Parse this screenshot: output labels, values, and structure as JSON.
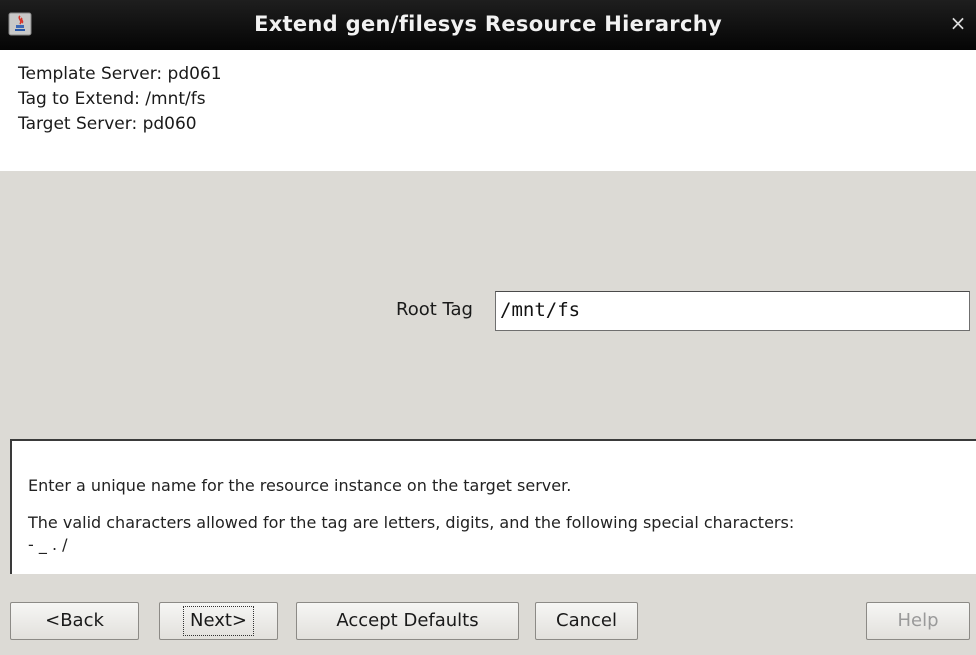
{
  "window": {
    "title": "Extend gen/filesys Resource Hierarchy",
    "close_glyph": "×"
  },
  "info": {
    "template_server": "Template Server: pd061",
    "tag_to_extend": "Tag to Extend: /mnt/fs",
    "target_server": "Target Server: pd060"
  },
  "form": {
    "root_tag_label": "Root Tag",
    "root_tag_value": "/mnt/fs"
  },
  "description": {
    "line1": "Enter a unique name for the resource instance on the target server.",
    "line2": "The valid characters allowed for the tag are letters, digits, and the following special characters:",
    "line3": "- _ . /"
  },
  "buttons": {
    "back": "<Back",
    "next": "Next>",
    "accept_defaults": "Accept Defaults",
    "cancel": "Cancel",
    "help": "Help"
  },
  "colors": {
    "titlebar": "#0a0a0a",
    "panel": "#dcdad5",
    "content": "#ffffff"
  }
}
